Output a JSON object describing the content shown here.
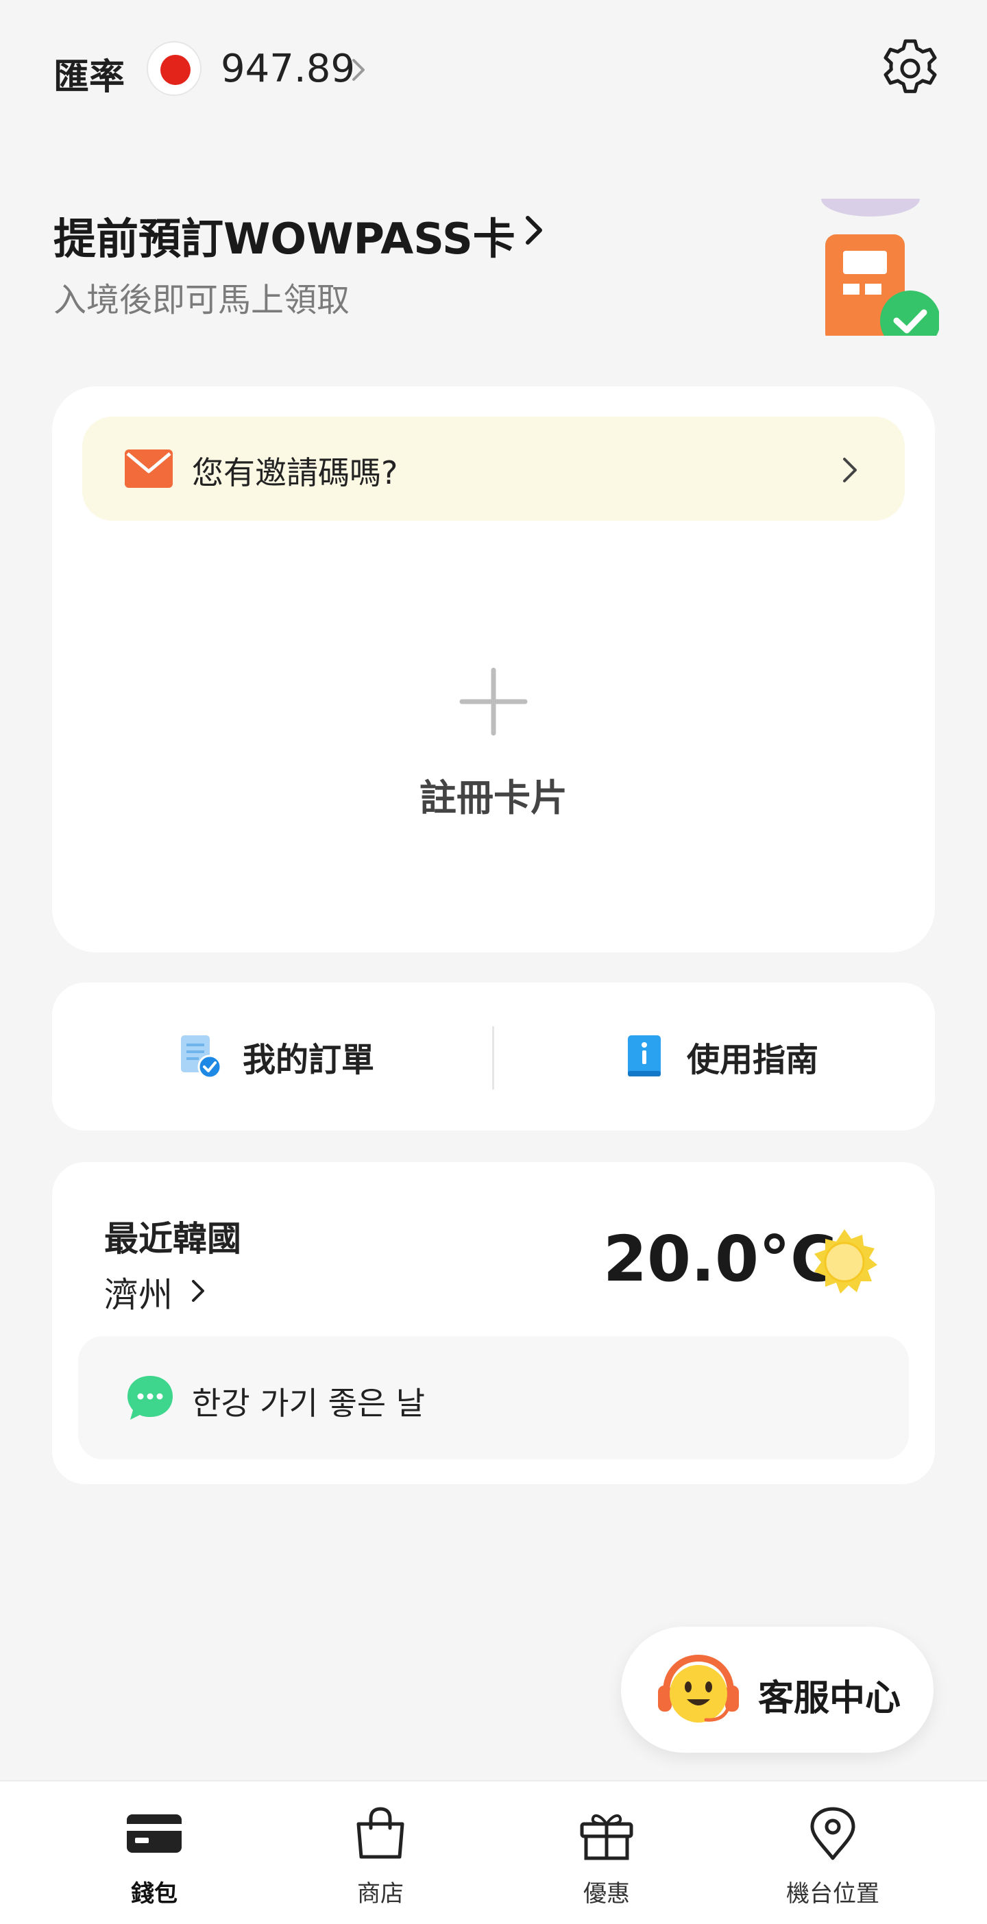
{
  "header": {
    "rate_label": "匯率",
    "flag_icon": "japan-flag-icon",
    "rate_value": "947.89",
    "settings_icon": "gear-icon"
  },
  "promo": {
    "title": "提前預訂WOWPASS卡",
    "subtitle": "入境後即可馬上領取",
    "art_icon": "kiosk-check-illustration"
  },
  "card_panel": {
    "invite_text": "您有邀請碼嗎?",
    "invite_icon": "envelope-icon",
    "register_label": "註冊卡片",
    "plus_icon": "plus-icon"
  },
  "quick_links": [
    {
      "label": "我的訂單",
      "icon": "order-doc-icon"
    },
    {
      "label": "使用指南",
      "icon": "guide-book-icon"
    }
  ],
  "weather": {
    "label": "最近韓國",
    "city": "濟州",
    "temperature": "20.0°C",
    "condition_icon": "sun-icon",
    "note": "한강 가기 좋은 날",
    "note_icon": "chat-bubble-icon"
  },
  "support": {
    "label": "客服中心",
    "icon": "support-agent-icon"
  },
  "bottom_nav": [
    {
      "label": "錢包",
      "icon": "wallet-card-icon",
      "active": true
    },
    {
      "label": "商店",
      "icon": "shopping-bag-icon",
      "active": false
    },
    {
      "label": "優惠",
      "icon": "gift-icon",
      "active": false
    },
    {
      "label": "機台位置",
      "icon": "location-pin-icon",
      "active": false
    }
  ],
  "colors": {
    "background": "#f5f5f5",
    "invite_bg": "#fbf8e3",
    "accent_orange": "#f26b3a",
    "sun_yellow": "#f7d33a",
    "chat_green": "#3dd68c",
    "guide_blue": "#2aa2f0"
  }
}
